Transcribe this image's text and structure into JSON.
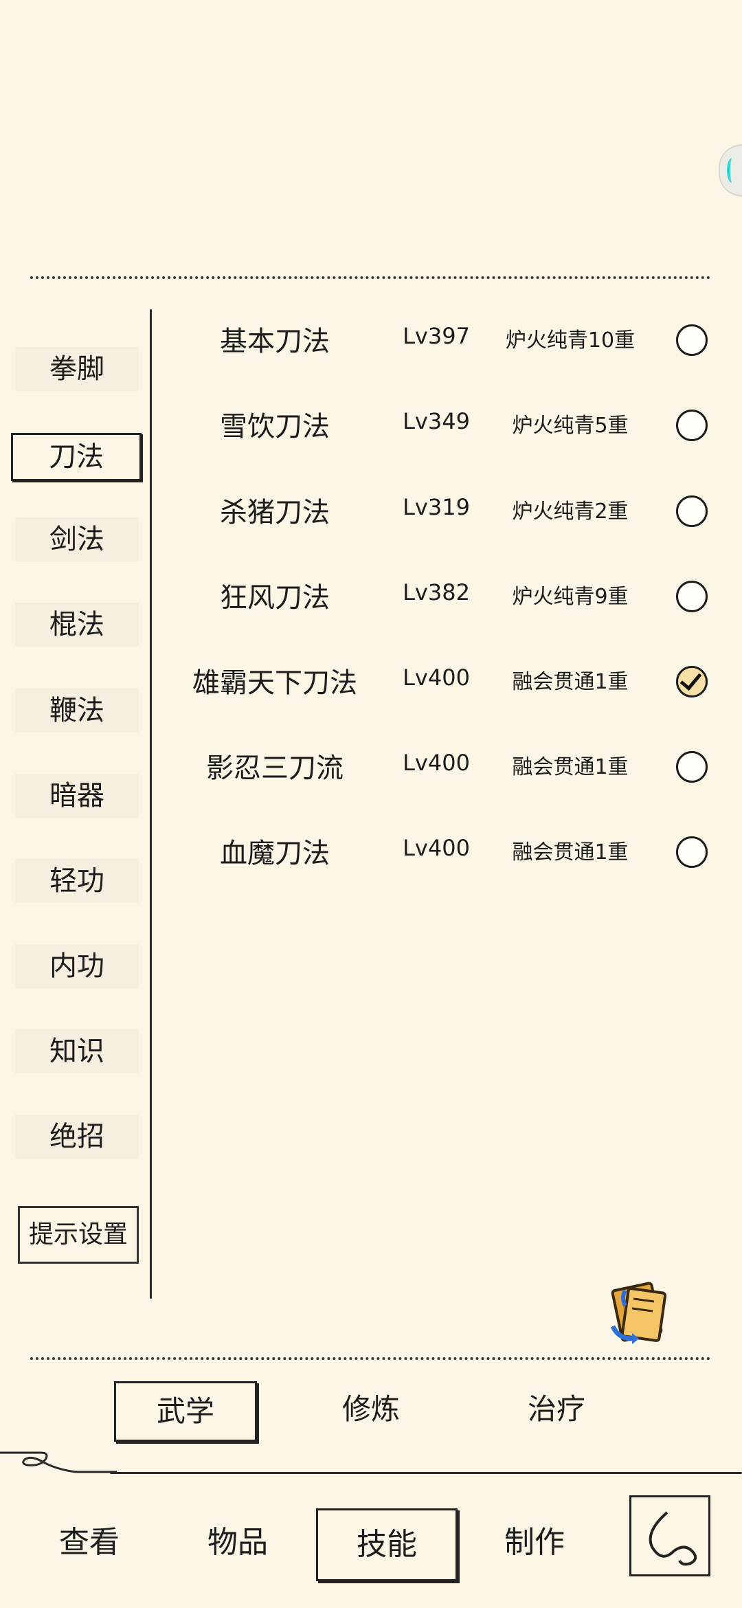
{
  "categories": [
    {
      "label": "拳脚",
      "active": false
    },
    {
      "label": "刀法",
      "active": true
    },
    {
      "label": "剑法",
      "active": false
    },
    {
      "label": "棍法",
      "active": false
    },
    {
      "label": "鞭法",
      "active": false
    },
    {
      "label": "暗器",
      "active": false
    },
    {
      "label": "轻功",
      "active": false
    },
    {
      "label": "内功",
      "active": false
    },
    {
      "label": "知识",
      "active": false
    },
    {
      "label": "绝招",
      "active": false
    }
  ],
  "hint_settings_label": "提示设置",
  "skills": [
    {
      "name": "基本刀法",
      "level": "Lv397",
      "rank": "炉火纯青10重",
      "selected": false
    },
    {
      "name": "雪饮刀法",
      "level": "Lv349",
      "rank": "炉火纯青5重",
      "selected": false
    },
    {
      "name": "杀猪刀法",
      "level": "Lv319",
      "rank": "炉火纯青2重",
      "selected": false
    },
    {
      "name": "狂风刀法",
      "level": "Lv382",
      "rank": "炉火纯青9重",
      "selected": false
    },
    {
      "name": "雄霸天下刀法",
      "level": "Lv400",
      "rank": "融会贯通1重",
      "selected": true
    },
    {
      "name": "影忍三刀流",
      "level": "Lv400",
      "rank": "融会贯通1重",
      "selected": false
    },
    {
      "name": "血魔刀法",
      "level": "Lv400",
      "rank": "融会贯通1重",
      "selected": false
    }
  ],
  "subtabs": [
    {
      "label": "武学",
      "active": true
    },
    {
      "label": "修炼",
      "active": false
    },
    {
      "label": "治疗",
      "active": false
    }
  ],
  "nav": [
    {
      "label": "查看",
      "active": false
    },
    {
      "label": "物品",
      "active": false
    },
    {
      "label": "技能",
      "active": true
    },
    {
      "label": "制作",
      "active": false
    }
  ],
  "icons": {
    "book": "book-swap-icon",
    "back": "back-icon",
    "side_handle": "side-handle-icon"
  }
}
